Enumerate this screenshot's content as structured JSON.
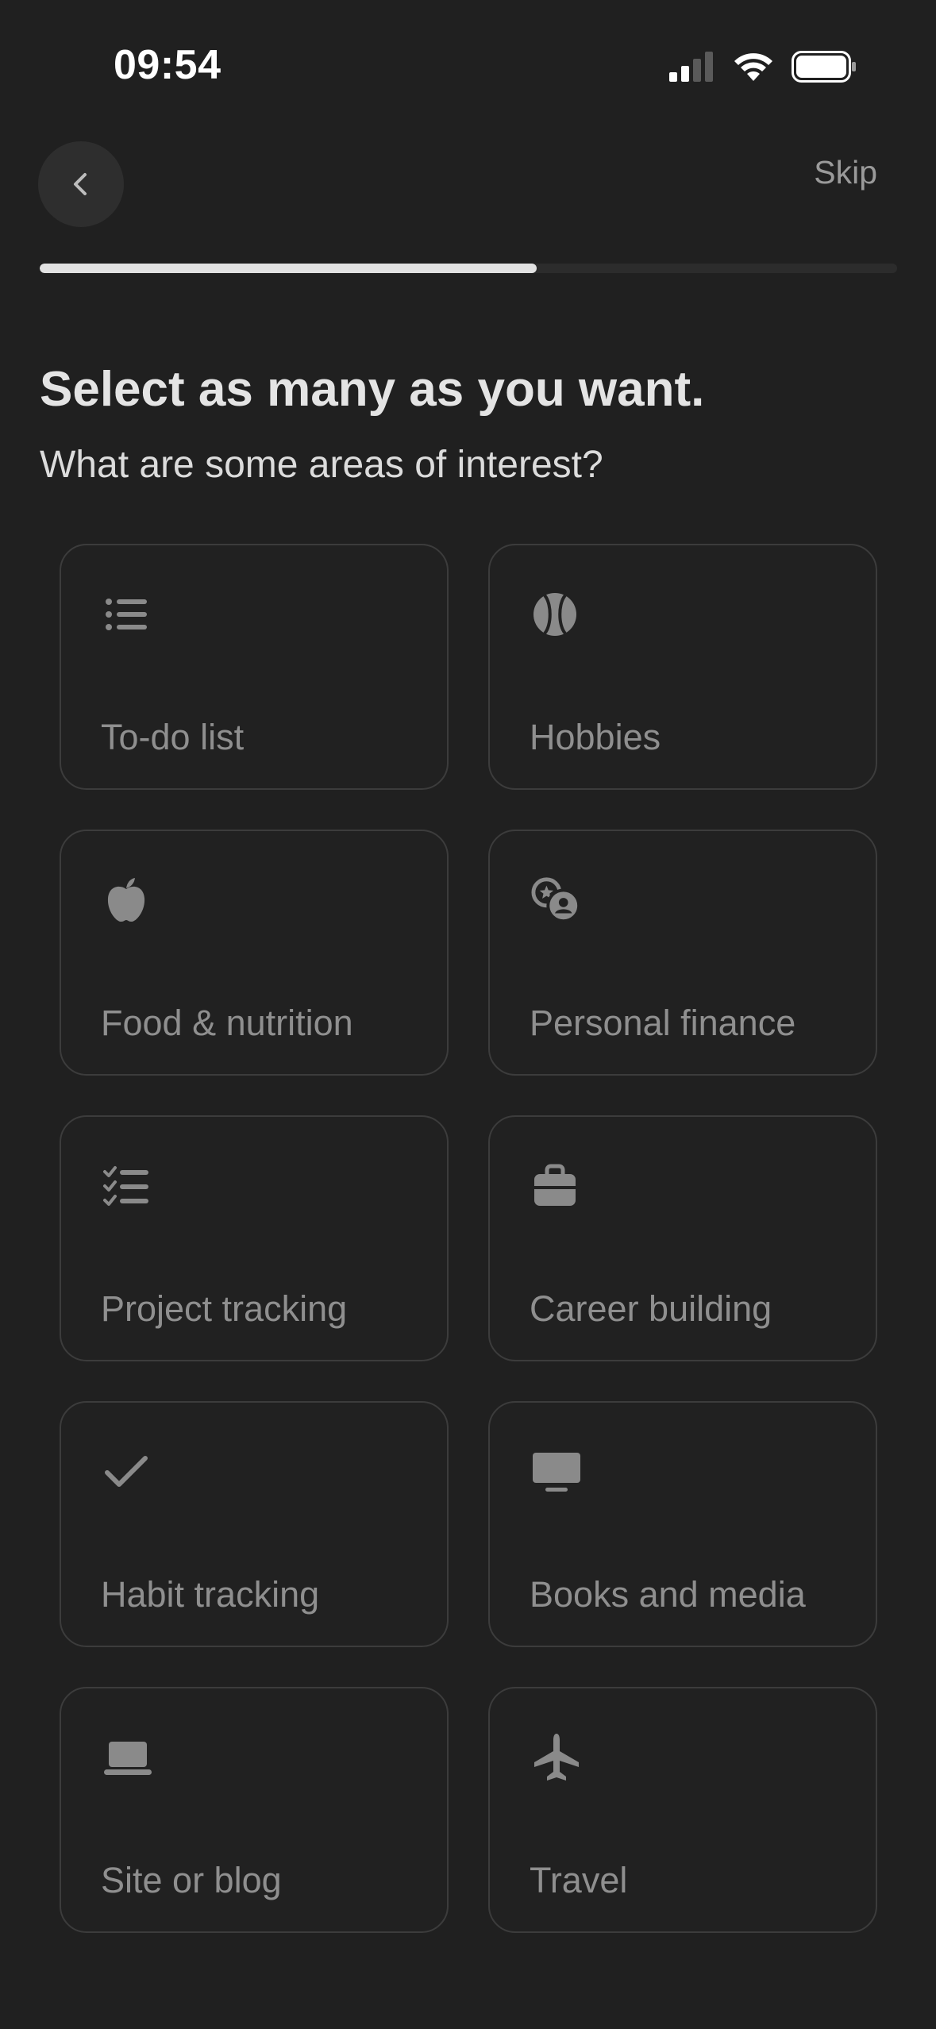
{
  "status_bar": {
    "time": "09:54",
    "signal_icon": "cellular-signal-icon",
    "wifi_icon": "wifi-icon",
    "battery_icon": "battery-icon"
  },
  "header": {
    "back_icon": "chevron-left-icon",
    "skip_label": "Skip"
  },
  "progress": {
    "fraction": 0.58
  },
  "heading": "Select as many as you want.",
  "subheading": "What are some areas of interest?",
  "options": [
    {
      "label": "To-do list",
      "icon": "bulleted-list-icon"
    },
    {
      "label": "Hobbies",
      "icon": "baseball-icon"
    },
    {
      "label": "Food & nutrition",
      "icon": "apple-icon"
    },
    {
      "label": "Personal finance",
      "icon": "coins-icon"
    },
    {
      "label": "Project tracking",
      "icon": "checklist-icon"
    },
    {
      "label": "Career building",
      "icon": "briefcase-icon"
    },
    {
      "label": "Habit tracking",
      "icon": "checkmark-icon"
    },
    {
      "label": "Books and media",
      "icon": "monitor-icon"
    },
    {
      "label": "Site or blog",
      "icon": "laptop-icon"
    },
    {
      "label": "Travel",
      "icon": "airplane-icon"
    }
  ],
  "colors": {
    "background": "#202020",
    "card_border": "#3c3c3c",
    "icon": "#8a8a8a",
    "label": "#8f8f8f",
    "progress_fill": "#e2e2e2",
    "progress_track": "#2c2c2c"
  }
}
